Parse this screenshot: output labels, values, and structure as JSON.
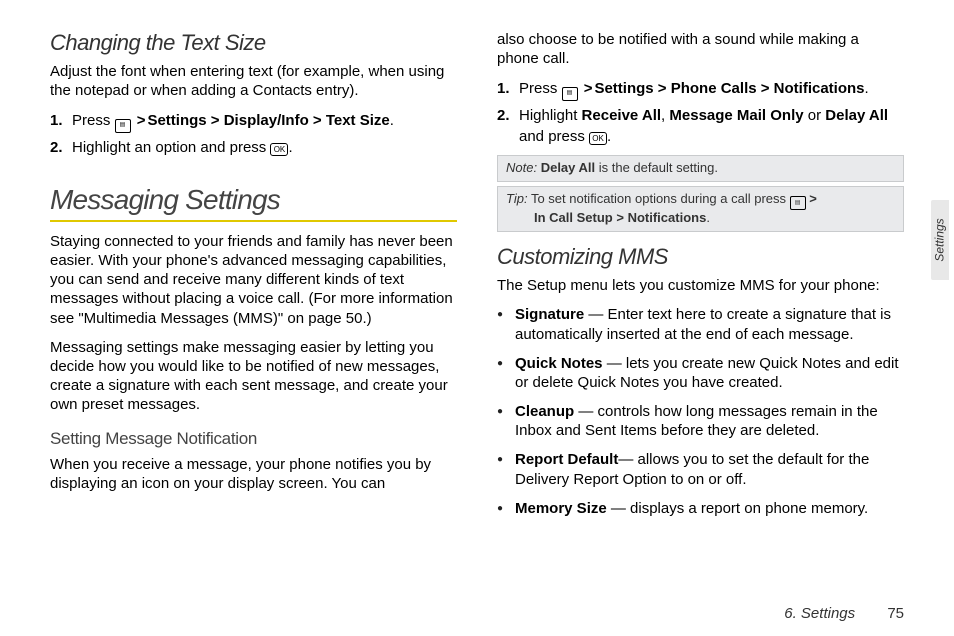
{
  "side_tab": "Settings",
  "footer": {
    "chapter": "6. Settings",
    "page": "75"
  },
  "left": {
    "h_text_size": "Changing the Text Size",
    "p_text_size": "Adjust the font when entering text (for example, when using the notepad or when adding a Contacts entry).",
    "ol_text_size": {
      "i1_pre": "Press ",
      "i1_path": "Settings > Display/Info > Text Size",
      "i2_pre": "Highlight an option and press "
    },
    "h1_msg": "Messaging Settings",
    "p_msg1": "Staying connected to your friends and family has never been easier. With your phone's advanced messaging capabilities, you can send and receive many different kinds of text messages without placing a voice call. (For more information see \"Multimedia Messages (MMS)\" on page 50.)",
    "p_msg2": "Messaging settings make messaging easier by letting you decide how you would like to be notified of new messages, create a signature with each sent message, and create your own preset messages.",
    "sub_notif": "Setting Message Notification",
    "p_notif": "When you receive a message, your phone notifies you by displaying an icon on your display screen. You can"
  },
  "right": {
    "p_cont": "also choose to be notified with a sound while making a phone call.",
    "ol_notif": {
      "i1_pre": "Press ",
      "i1_path": "Settings > Phone Calls > Notifications",
      "i2_a": "Highlight ",
      "i2_b": "Receive All",
      "i2_c": ", ",
      "i2_d": "Message Mail Only",
      "i2_e": " or ",
      "i2_f": "Delay All",
      "i2_g": " and press "
    },
    "note": {
      "label": "Note:",
      "b": "Delay All",
      "rest": " is the default setting."
    },
    "tip": {
      "label": "Tip:",
      "line1": " To set notification options during a call press ",
      "line2a": "In Call Setup",
      "line2b": "Notifications"
    },
    "h_mms": "Customizing MMS",
    "p_mms": "The Setup menu lets you customize MMS for your phone:",
    "bullets": {
      "b1_t": "Signature",
      "b1_r": " — Enter text here to create a signature that is automatically inserted at the end of each message.",
      "b2_t": "Quick Notes",
      "b2_r": " — lets you create new Quick Notes and edit or delete Quick Notes you have created.",
      "b3_t": "Cleanup",
      "b3_r": " — controls how long messages remain in the Inbox and Sent Items before they are deleted.",
      "b4_t": "Report Default",
      "b4_r": "— allows you to set the default for the Delivery Report Option to on or off.",
      "b5_t": "Memory Size",
      "b5_r": " — displays a report on phone memory."
    }
  }
}
